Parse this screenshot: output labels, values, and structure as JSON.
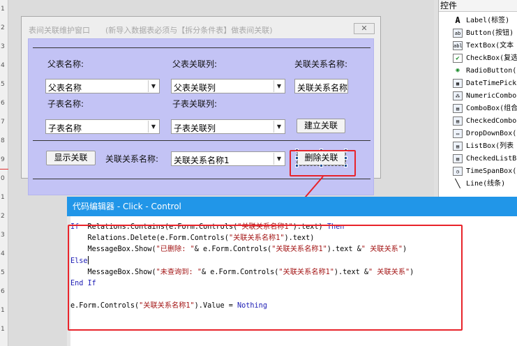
{
  "ruler": {
    "marks": [
      "1",
      "2",
      "3",
      "4",
      "5",
      "6",
      "7",
      "8",
      "9",
      "0",
      "1",
      "2",
      "3",
      "4",
      "5",
      "6",
      "1",
      "1"
    ]
  },
  "form": {
    "title": "表间关联维护窗口",
    "hint": "(新导入数据表必须与【拆分条件表】做表间关联)",
    "close_glyph": "✕",
    "parent_table_label": "父表名称:",
    "parent_column_label": "父表关联列:",
    "relation_name_label": "关联关系名称:",
    "parent_table_combo": "父表名称",
    "parent_column_combo": "父表关联列",
    "relation_name_box": "关联关系名称",
    "child_table_label": "子表名称:",
    "child_column_label": "子表关联列:",
    "child_table_combo": "子表名称",
    "child_column_combo": "子表关联列",
    "build_button": "建立关联",
    "show_button": "显示关联",
    "relation_name_label2": "关联关系名称:",
    "relation_combo": "关联关系名称1",
    "delete_button": "删除关联",
    "combo_arrow": "▼"
  },
  "code_editor": {
    "title": "代码编辑器 - Click - Control",
    "lines": [
      [
        [
          "kw",
          "If"
        ],
        [
          "",
          "  Relations.Contains(e.Form.Controls("
        ],
        [
          "str",
          "\"关联关系名称1\""
        ],
        [
          "",
          ").text) "
        ],
        [
          "kw",
          "Then"
        ]
      ],
      [
        [
          "",
          "    Relations.Delete(e.Form.Controls("
        ],
        [
          "str",
          "\"关联关系名称1\""
        ],
        [
          "",
          ").text)"
        ]
      ],
      [
        [
          "",
          "    MessageBox.Show("
        ],
        [
          "str",
          "\"已删除: \""
        ],
        [
          "",
          "& e.Form.Controls("
        ],
        [
          "str",
          "\"关联关系名称1\""
        ],
        [
          "",
          ").text &"
        ],
        [
          "str",
          "\" 关联关系\""
        ],
        [
          "",
          ")"
        ]
      ],
      [
        [
          "kw",
          "Else"
        ]
      ],
      [
        [
          "",
          "    MessageBox.Show("
        ],
        [
          "str",
          "\"未查询到: \""
        ],
        [
          "",
          "& e.Form.Controls("
        ],
        [
          "str",
          "\"关联关系名称1\""
        ],
        [
          "",
          ").text &"
        ],
        [
          "str",
          "\" 关联关系\""
        ],
        [
          "",
          ")"
        ]
      ],
      [
        [
          "kw",
          "End If"
        ]
      ],
      [],
      [
        [
          "",
          "e.Form.Controls("
        ],
        [
          "str",
          "\"关联关系名称1\""
        ],
        [
          "",
          ").Value = "
        ],
        [
          "kw",
          "Nothing"
        ]
      ]
    ]
  },
  "toolbox": {
    "title": "控件",
    "items": [
      {
        "icon": "label-icon",
        "glyph": "A",
        "label": "Label(标签)"
      },
      {
        "icon": "button-icon",
        "glyph": "ab",
        "label": "Button(按钮)"
      },
      {
        "icon": "textbox-icon",
        "glyph": "abl",
        "label": "TextBox(文本"
      },
      {
        "icon": "checkbox-icon",
        "glyph": "✔",
        "label": "CheckBox(复选"
      },
      {
        "icon": "radio-icon",
        "glyph": "◉",
        "label": "RadioButton("
      },
      {
        "icon": "datetime-icon",
        "glyph": "▦",
        "label": "DateTimePick"
      },
      {
        "icon": "numeric-icon",
        "glyph": "⁂",
        "label": "NumericCombo"
      },
      {
        "icon": "combobox-icon",
        "glyph": "▤",
        "label": "ComboBox(组合"
      },
      {
        "icon": "checkedcombo-icon",
        "glyph": "▤",
        "label": "CheckedCombo"
      },
      {
        "icon": "dropdownbox-icon",
        "glyph": "▭",
        "label": "DropDownBox("
      },
      {
        "icon": "listbox-icon",
        "glyph": "▤",
        "label": "ListBox(列表"
      },
      {
        "icon": "checkedlist-icon",
        "glyph": "▤",
        "label": "CheckedListB"
      },
      {
        "icon": "timespan-icon",
        "glyph": "◷",
        "label": "TimeSpanBox("
      },
      {
        "icon": "line-icon",
        "glyph": "╲",
        "label": "Line(线条)"
      }
    ]
  },
  "colors": {
    "accent": "#2196e8",
    "highlight": "#e8232a",
    "form_body": "#c3c3f5"
  }
}
